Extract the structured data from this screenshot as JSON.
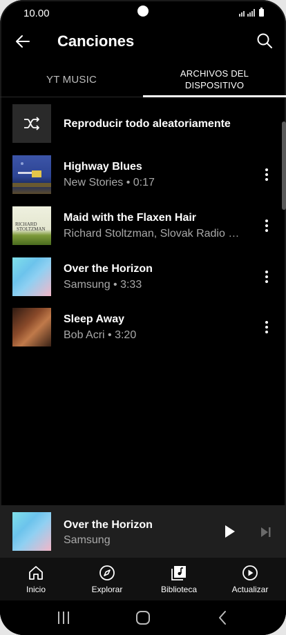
{
  "status": {
    "time": "10.00"
  },
  "appbar": {
    "title": "Canciones"
  },
  "tabs": [
    {
      "label": "YT MUSIC",
      "active": false
    },
    {
      "label": "ARCHIVOS DEL DISPOSITIVO",
      "active": true
    }
  ],
  "shuffle": {
    "label": "Reproducir todo aleatoriamente",
    "icon": "shuffle-icon"
  },
  "songs": [
    {
      "title": "Highway Blues",
      "subtitle": "New Stories • 0:17"
    },
    {
      "title": "Maid with the Flaxen Hair",
      "subtitle": "Richard Stoltzman, Slovak Radio Sy…",
      "art_text_1": "RICHARD",
      "art_text_2": "STOLTZMAN"
    },
    {
      "title": "Over the Horizon",
      "subtitle": "Samsung • 3:33"
    },
    {
      "title": "Sleep Away",
      "subtitle": "Bob Acri • 3:20"
    }
  ],
  "miniplayer": {
    "title": "Over the Horizon",
    "artist": "Samsung"
  },
  "bottomnav": [
    {
      "label": "Inicio",
      "icon": "home-icon"
    },
    {
      "label": "Explorar",
      "icon": "compass-icon"
    },
    {
      "label": "Biblioteca",
      "icon": "library-icon"
    },
    {
      "label": "Actualizar",
      "icon": "upgrade-icon"
    }
  ],
  "colors": {
    "background": "#000000",
    "secondary_text": "#a9a9a9",
    "miniplayer_bg": "#1f1f1f"
  }
}
